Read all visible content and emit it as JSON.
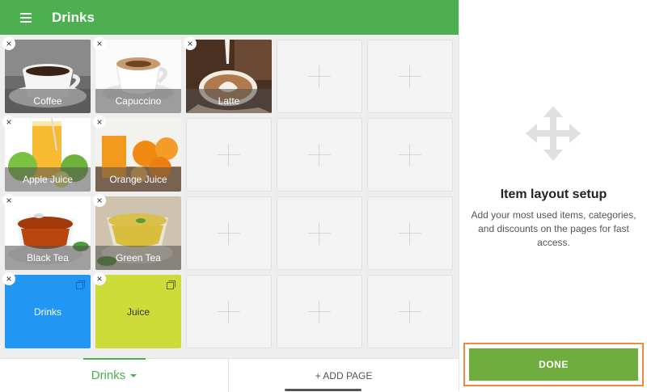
{
  "appbar": {
    "title": "Drinks",
    "menu_icon": "hamburger-menu-icon"
  },
  "items": [
    {
      "label": "Coffee",
      "image": "coffee-cup"
    },
    {
      "label": "Capuccino",
      "image": "cappuccino-cup"
    },
    {
      "label": "Latte",
      "image": "latte-art"
    },
    {
      "label": "Apple Juice",
      "image": "apple-juice-glass"
    },
    {
      "label": "Orange Juice",
      "image": "orange-juice-glass"
    },
    {
      "label": "Black Tea",
      "image": "black-tea-cup"
    },
    {
      "label": "Green Tea",
      "image": "green-tea-cup"
    }
  ],
  "categories": [
    {
      "label": "Drinks",
      "color": "#2196f3"
    },
    {
      "label": "Juice",
      "color": "#cddc39"
    }
  ],
  "remove_symbol": "×",
  "bottom": {
    "page_tab": "Drinks",
    "add_page": "+ ADD PAGE"
  },
  "setup": {
    "title": "Item layout setup",
    "description": "Add your most used items, categories, and discounts on the pages for fast access.",
    "done": "DONE"
  },
  "colors": {
    "appbar": "#4caf50",
    "done": "#6fae3e",
    "highlight": "#f0883e"
  }
}
